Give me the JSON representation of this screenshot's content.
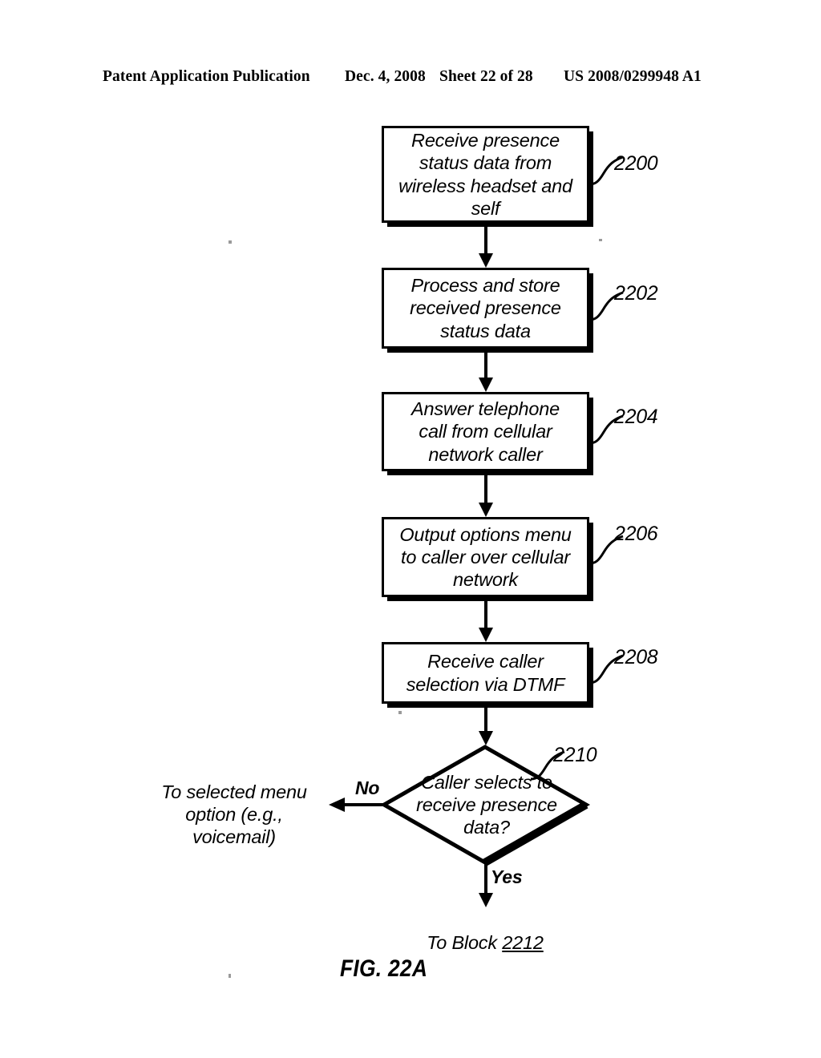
{
  "header": {
    "publication": "Patent Application Publication",
    "date": "Dec. 4, 2008",
    "sheet": "Sheet 22 of 28",
    "patent_number": "US 2008/0299948 A1"
  },
  "figure": {
    "caption": "FIG. 22A",
    "nodes": [
      {
        "id": "2200",
        "type": "process",
        "text": "Receive presence\nstatus data from\nwireless headset and\nself",
        "ref": "2200"
      },
      {
        "id": "2202",
        "type": "process",
        "text": "Process and store\nreceived presence\nstatus data",
        "ref": "2202"
      },
      {
        "id": "2204",
        "type": "process",
        "text": "Answer telephone\ncall from cellular\nnetwork caller",
        "ref": "2204"
      },
      {
        "id": "2206",
        "type": "process",
        "text": "Output options menu\nto caller over cellular\nnetwork",
        "ref": "2206"
      },
      {
        "id": "2208",
        "type": "process",
        "text": "Receive caller\nselection via DTMF",
        "ref": "2208"
      },
      {
        "id": "2210",
        "type": "decision",
        "text": "Caller selects to\nreceive presence\ndata?",
        "ref": "2210"
      }
    ],
    "branches": {
      "no_label": "No",
      "yes_label": "Yes",
      "no_target": "To selected menu\noption (e.g., voicemail)",
      "yes_target_prefix": "To Block ",
      "yes_target_number": "2212"
    }
  }
}
